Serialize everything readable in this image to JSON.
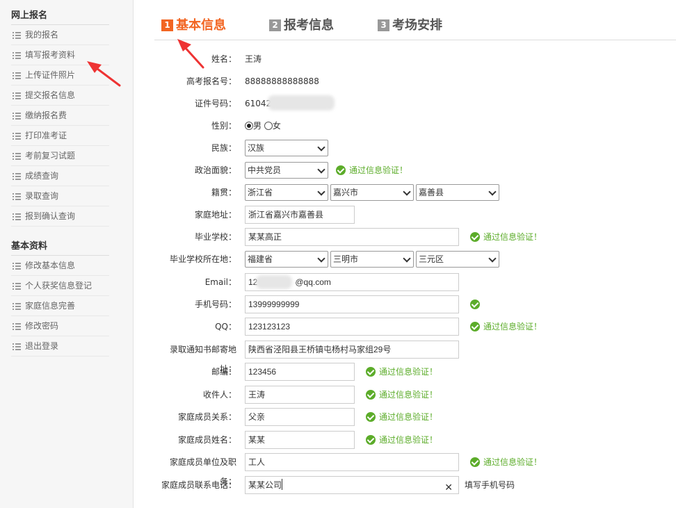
{
  "sidebar": {
    "section1_title": "网上报名",
    "section1_items": [
      "我的报名",
      "填写报考资料",
      "上传证件照片",
      "提交报名信息",
      "缴纳报名费",
      "打印准考证",
      "考前复习试题",
      "成绩查询",
      "录取查询",
      "报到确认查询"
    ],
    "section2_title": "基本资料",
    "section2_items": [
      "修改基本信息",
      "个人获奖信息登记",
      "家庭信息完善",
      "修改密码",
      "退出登录"
    ]
  },
  "tabs": [
    {
      "num": "1",
      "label": "基本信息",
      "active": true
    },
    {
      "num": "2",
      "label": "报考信息",
      "active": false
    },
    {
      "num": "3",
      "label": "考场安排",
      "active": false
    }
  ],
  "form": {
    "name_label": "姓名：",
    "name_value": "王涛",
    "exam_no_label": "高考报名号：",
    "exam_no_value": "88888888888888",
    "id_label": "证件号码：",
    "id_value": "61042",
    "gender_label": "性别：",
    "gender_male": "男",
    "gender_female": "女",
    "ethnic_label": "民族：",
    "ethnic_value": "汉族",
    "politics_label": "政治面貌：",
    "politics_value": "中共党员",
    "native_label": "籍贯：",
    "native_province": "浙江省",
    "native_city": "嘉兴市",
    "native_county": "嘉善县",
    "address_label": "家庭地址：",
    "address_value": "浙江省嘉兴市嘉善县",
    "school_label": "毕业学校：",
    "school_value": "某某高正",
    "school_loc_label": "毕业学校所在地：",
    "school_province": "福建省",
    "school_city": "三明市",
    "school_county": "三元区",
    "email_label": "Email：",
    "email_prefix": "12",
    "email_suffix": "@qq.com",
    "phone_label": "手机号码：",
    "phone_value": "13999999999",
    "qq_label": "QQ：",
    "qq_value": "123123123",
    "mail_addr_label": "录取通知书邮寄地址：",
    "mail_addr_value": "陕西省泾阳县王桥镇屯杨村马家组29号",
    "zip_label": "邮编：",
    "zip_value": "123456",
    "receiver_label": "收件人：",
    "receiver_value": "王涛",
    "relation_label": "家庭成员关系：",
    "relation_value": "父亲",
    "member_name_label": "家庭成员姓名：",
    "member_name_value": "某某",
    "member_job_label": "家庭成员单位及职务：",
    "member_job_value": "工人",
    "member_phone_label": "家庭成员联系电话：",
    "member_phone_value": "某某公司",
    "member_phone_hint": "填写手机号码",
    "verify_text": "通过信息验证！"
  },
  "colors": {
    "accent": "#f26522",
    "success": "#5cac2a",
    "annotation": "#ee3333"
  }
}
